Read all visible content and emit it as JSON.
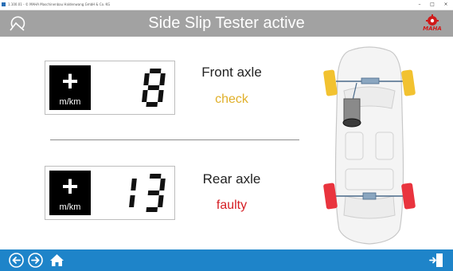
{
  "window": {
    "title": "1.100.01 - © MAHA Maschinenbau Haldenwang GmbH & Co. KG",
    "min": "–",
    "max": "□",
    "close": "×"
  },
  "header": {
    "title": "Side Slip Tester active",
    "brand": "MAHA"
  },
  "front": {
    "sign": "+",
    "unit": "m/km",
    "value": "8",
    "label": "Front axle",
    "status": "check",
    "status_color": "#e0b02a"
  },
  "rear": {
    "sign": "+",
    "unit": "m/km",
    "value": "13",
    "label": "Rear axle",
    "status": "faulty",
    "status_color": "#d51e24"
  },
  "colors": {
    "header_bg": "#a2a2a2",
    "footer_bg": "#1e84c9",
    "front_wheels": "#f2c230",
    "rear_wheels": "#e9343e"
  },
  "footer": {
    "icons": [
      "back-arrow-icon",
      "forward-arrow-icon",
      "home-icon",
      "exit-icon"
    ]
  }
}
